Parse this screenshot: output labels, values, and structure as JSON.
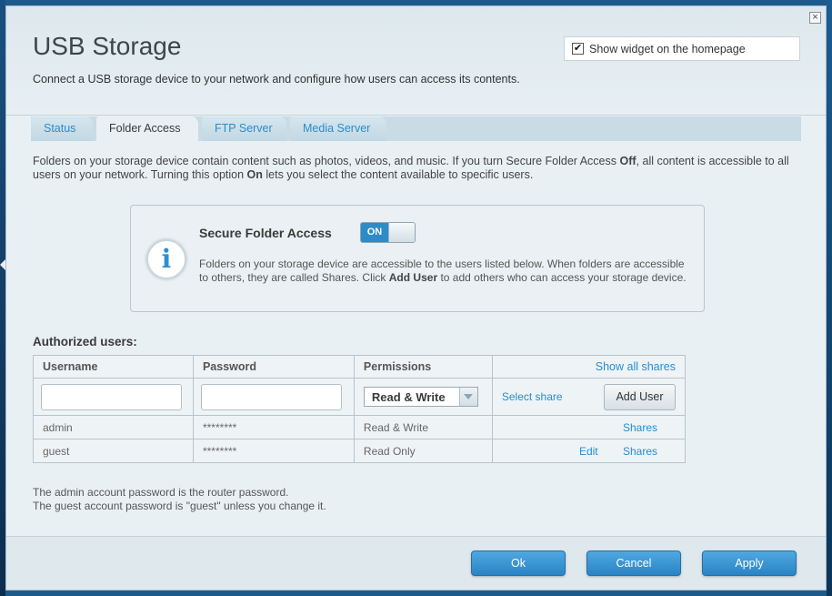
{
  "dialog": {
    "title": "USB Storage",
    "subtitle": "Connect a USB storage device to your network and configure how users can access its contents.",
    "close_glyph": "×",
    "widget_checkbox": {
      "label": "Show widget on the homepage",
      "checked": true,
      "check_glyph": "✔"
    }
  },
  "tabs": [
    {
      "label": "Status",
      "active": false
    },
    {
      "label": "Folder Access",
      "active": true
    },
    {
      "label": "FTP Server",
      "active": false
    },
    {
      "label": "Media Server",
      "active": false
    }
  ],
  "intro": {
    "part1": "Folders on your storage device contain content such as photos, videos, and music. If you turn Secure Folder Access ",
    "bold1": "Off",
    "part2": ", all content is accessible to all users on your network. Turning this option ",
    "bold2": "On",
    "part3": " lets you select the content available to specific users."
  },
  "secure_access": {
    "title": "Secure Folder Access",
    "toggle_label": "ON",
    "icon_glyph": "i",
    "text1": "Folders on your storage device are accessible to the users listed below. When folders are accessible to others, they are called Shares. Click ",
    "bold": "Add User",
    "text2": " to add others who can access your storage device."
  },
  "authorized_users": {
    "title": "Authorized users:",
    "columns": {
      "username": "Username",
      "password": "Password",
      "permissions": "Permissions",
      "show_all": "Show all shares"
    },
    "new_user": {
      "username_value": "",
      "password_value": "",
      "permission": "Read & Write",
      "select_share": "Select share",
      "add_button": "Add User"
    },
    "rows": [
      {
        "username": "admin",
        "password": "********",
        "permission": "Read & Write",
        "edit": "",
        "shares": "Shares"
      },
      {
        "username": "guest",
        "password": "********",
        "permission": "Read Only",
        "edit": "Edit",
        "shares": "Shares"
      }
    ]
  },
  "notes": [
    "The admin account password is the router password.",
    "The guest account password is \"guest\" unless you change it."
  ],
  "footer": {
    "ok": "Ok",
    "cancel": "Cancel",
    "apply": "Apply"
  },
  "colors": {
    "accent": "#2a8ccd",
    "toggle_on": "#2d8bc8",
    "button": "#3a95d3"
  }
}
